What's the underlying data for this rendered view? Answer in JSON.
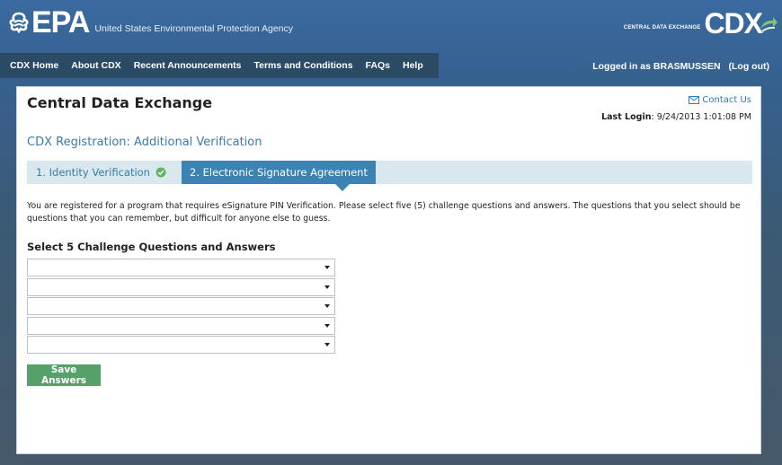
{
  "header": {
    "epa_mark": "EPA",
    "agency_name": "United States Environmental Protection Agency",
    "cdx_small": "CENTRAL DATA EXCHANGE",
    "cdx_big": "CDX"
  },
  "nav": {
    "items": [
      "CDX Home",
      "About CDX",
      "Recent Announcements",
      "Terms and Conditions",
      "FAQs",
      "Help"
    ],
    "logged_in_text": "Logged in as BRASMUSSEN",
    "logout_label": "(Log out)"
  },
  "page": {
    "title": "Central Data Exchange",
    "contact_label": "Contact Us",
    "last_login_label": "Last Login",
    "last_login_value": ": 9/24/2013 1:01:08 PM",
    "subtitle": "CDX Registration: Additional Verification"
  },
  "steps": {
    "step1": "1. Identity Verification",
    "step2": "2. Electronic Signature Agreement"
  },
  "form": {
    "instructions": "You are registered for a program that requires eSignature PIN Verification. Please select five (5) challenge questions and answers. The questions that you select should be questions that you can remember, but difficult for anyone else to guess.",
    "section_heading": "Select 5 Challenge Questions and Answers",
    "selects": [
      "",
      "",
      "",
      "",
      ""
    ],
    "save_label": "Save Answers"
  },
  "colors": {
    "nav_bg": "#2a4a66",
    "accent_blue": "#3a83b2",
    "link_blue": "#2f7ab8",
    "save_green": "#56a06a",
    "check_green": "#5cb85c"
  },
  "icons": {
    "epa_logo": "epa-flower-icon",
    "cdx_arrow": "cdx-arrow-icon",
    "contact": "envelope-icon",
    "step_check": "check-circle-icon",
    "select_caret": "chevron-down-icon"
  }
}
